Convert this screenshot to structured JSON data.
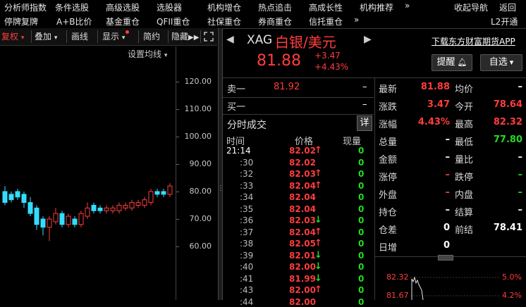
{
  "nav": {
    "row1": [
      "分析师指数",
      "条件选股",
      "高级选股",
      "选股器",
      "机构增仓",
      "热点追击",
      "高成长性",
      "机构推荐",
      "»",
      "收起导航",
      "返回"
    ],
    "row2": [
      "停牌复牌",
      "A+B比价",
      "基金重仓",
      "QFII重仓",
      "社保重仓",
      "券商重仓",
      "信托重仓",
      "»",
      "L2开通"
    ]
  },
  "toolbar": {
    "fuquan": "复权",
    "diejia": "叠加",
    "huaxian": "画线",
    "xianshi": "显示",
    "jianjia": "简约",
    "yincang": "隐藏",
    "settings": "设置均线"
  },
  "chart": {
    "yticks": [
      "120.00",
      "110.00",
      "100.00",
      "90.00",
      "80.00",
      "70.00",
      "60.00"
    ],
    "candles": [
      {
        "o": 76,
        "c": 80,
        "h": 82,
        "l": 75,
        "up": false
      },
      {
        "o": 79,
        "c": 77,
        "h": 80,
        "l": 76,
        "up": false
      },
      {
        "o": 78,
        "c": 80,
        "h": 81,
        "l": 77,
        "up": false
      },
      {
        "o": 79,
        "c": 76,
        "h": 80,
        "l": 74,
        "up": false
      },
      {
        "o": 76,
        "c": 72,
        "h": 78,
        "l": 71,
        "up": false
      },
      {
        "o": 74,
        "c": 68,
        "h": 75,
        "l": 66,
        "up": false
      },
      {
        "o": 70,
        "c": 67,
        "h": 71,
        "l": 64,
        "up": false
      },
      {
        "o": 67,
        "c": 70,
        "h": 71,
        "l": 62,
        "up": true
      },
      {
        "o": 69,
        "c": 72,
        "h": 74,
        "l": 68,
        "up": true
      },
      {
        "o": 72,
        "c": 68,
        "h": 73,
        "l": 67,
        "up": false
      },
      {
        "o": 68,
        "c": 71,
        "h": 72,
        "l": 67,
        "up": true
      },
      {
        "o": 70,
        "c": 68,
        "h": 71,
        "l": 67,
        "up": false
      },
      {
        "o": 68,
        "c": 72,
        "h": 73,
        "l": 67,
        "up": true
      },
      {
        "o": 71,
        "c": 74,
        "h": 76,
        "l": 70,
        "up": true
      },
      {
        "o": 73,
        "c": 75,
        "h": 76,
        "l": 72,
        "up": false
      },
      {
        "o": 74,
        "c": 73,
        "h": 75,
        "l": 72,
        "up": false
      },
      {
        "o": 73,
        "c": 74,
        "h": 75,
        "l": 72,
        "up": true
      },
      {
        "o": 74,
        "c": 73,
        "h": 75,
        "l": 72,
        "up": true
      },
      {
        "o": 73,
        "c": 75,
        "h": 76,
        "l": 72,
        "up": true
      },
      {
        "o": 75,
        "c": 74,
        "h": 76,
        "l": 73,
        "up": true
      },
      {
        "o": 74,
        "c": 76,
        "h": 77,
        "l": 73,
        "up": true
      },
      {
        "o": 76,
        "c": 75,
        "h": 77,
        "l": 74,
        "up": true
      },
      {
        "o": 75,
        "c": 77,
        "h": 78,
        "l": 74,
        "up": true
      },
      {
        "o": 76,
        "c": 80,
        "h": 81,
        "l": 75,
        "up": true
      },
      {
        "o": 80,
        "c": 79,
        "h": 81,
        "l": 78,
        "up": false
      },
      {
        "o": 79,
        "c": 80,
        "h": 81,
        "l": 78,
        "up": false
      },
      {
        "o": 79,
        "c": 82,
        "h": 83,
        "l": 78,
        "up": true
      }
    ]
  },
  "quote": {
    "code": "XAG",
    "name": "白银/美元",
    "price": "81.88",
    "change": "+3.47",
    "change_pct": "+4.43%",
    "download_link": "下载东方财富期货APP",
    "remind_btn": "提醒",
    "zixuan_btn": "自选"
  },
  "orderbook": {
    "sell_label": "卖一",
    "sell_price": "81.92",
    "sell_vol": "–",
    "buy_label": "买一",
    "buy_vol": "–"
  },
  "trades": {
    "title": "分时成交",
    "detail_btn": "详",
    "headers": [
      "时间",
      "价格",
      "现量"
    ],
    "rows": [
      {
        "t": "21:14",
        "p": "82.02",
        "dir": "up",
        "v": "0"
      },
      {
        "t": ":30",
        "p": "82.02",
        "dir": "",
        "v": "0"
      },
      {
        "t": ":32",
        "p": "82.03",
        "dir": "up",
        "v": "0"
      },
      {
        "t": ":33",
        "p": "82.04",
        "dir": "up",
        "v": "0"
      },
      {
        "t": ":34",
        "p": "82.04",
        "dir": "",
        "v": "0"
      },
      {
        "t": ":35",
        "p": "82.04",
        "dir": "",
        "v": "0"
      },
      {
        "t": ":36",
        "p": "82.03",
        "dir": "down",
        "v": "0"
      },
      {
        "t": ":37",
        "p": "82.04",
        "dir": "up",
        "v": "0"
      },
      {
        "t": ":38",
        "p": "82.05",
        "dir": "up",
        "v": "0"
      },
      {
        "t": ":39",
        "p": "82.01",
        "dir": "down",
        "v": "0"
      },
      {
        "t": ":40",
        "p": "82.00",
        "dir": "down",
        "v": "0"
      },
      {
        "t": ":41",
        "p": "81.99",
        "dir": "down",
        "v": "0"
      },
      {
        "t": ":43",
        "p": "82.00",
        "dir": "up",
        "v": "0"
      },
      {
        "t": ":44",
        "p": "82.00",
        "dir": "",
        "v": "0"
      }
    ]
  },
  "stats": {
    "left": [
      {
        "label": "最新",
        "value": "81.88",
        "color": "red"
      },
      {
        "label": "涨跌",
        "value": "3.47",
        "color": "red"
      },
      {
        "label": "涨幅",
        "value": "4.43%",
        "color": "red"
      },
      {
        "label": "总量",
        "value": "–",
        "color": "white"
      },
      {
        "label": "金额",
        "value": "–",
        "color": "white"
      },
      {
        "label": "涨停",
        "value": "–",
        "color": "red"
      },
      {
        "label": "外盘",
        "value": "–",
        "color": "red"
      },
      {
        "label": "持仓",
        "value": "–",
        "color": "white"
      },
      {
        "label": "仓差",
        "value": "0",
        "color": "white"
      },
      {
        "label": "日增",
        "value": "0",
        "color": "white"
      }
    ],
    "right": [
      {
        "label": "均价",
        "value": "–",
        "color": "white"
      },
      {
        "label": "今开",
        "value": "78.64",
        "color": "red"
      },
      {
        "label": "最高",
        "value": "82.32",
        "color": "red"
      },
      {
        "label": "最低",
        "value": "77.80",
        "color": "green"
      },
      {
        "label": "量比",
        "value": "–",
        "color": "white"
      },
      {
        "label": "跌停",
        "value": "–",
        "color": "green"
      },
      {
        "label": "内盘",
        "value": "–",
        "color": "green"
      },
      {
        "label": "结算",
        "value": "–",
        "color": "white"
      },
      {
        "label": "前结",
        "value": "78.41",
        "color": "white"
      }
    ]
  },
  "minichart": {
    "left_top": "82.32",
    "left_bottom": "81.67",
    "right_top": "5.0%",
    "right_bottom": "4.2%"
  },
  "colors": {
    "up": "#ff3d3d",
    "down": "#22dd22",
    "bg": "#000000"
  }
}
